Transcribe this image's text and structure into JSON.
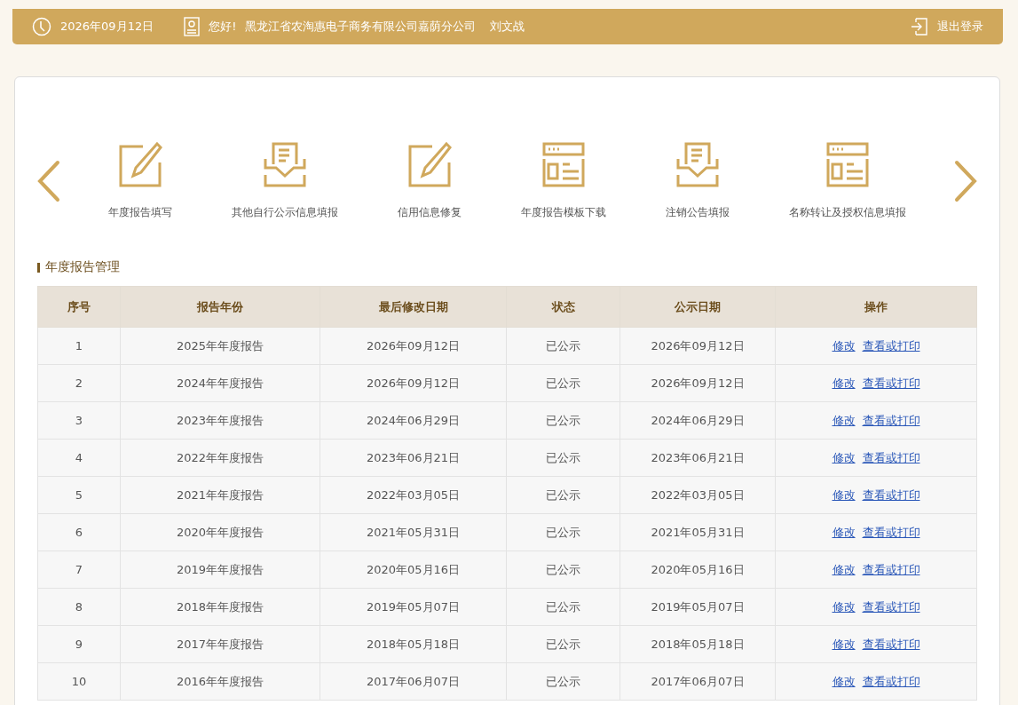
{
  "header": {
    "date": "2026年09月12日",
    "greeting": "您好!",
    "company": "黑龙江省农淘惠电子商务有限公司嘉荫分公司",
    "user": "刘文战",
    "logout": "退出登录"
  },
  "shortcuts": [
    {
      "kind": "edit",
      "label": "年度报告填写"
    },
    {
      "kind": "tray",
      "label": "其他自行公示信息填报"
    },
    {
      "kind": "edit",
      "label": "信用信息修复"
    },
    {
      "kind": "window",
      "label": "年度报告模板下载"
    },
    {
      "kind": "tray",
      "label": "注销公告填报"
    },
    {
      "kind": "window",
      "label": "名称转让及授权信息填报"
    }
  ],
  "section_title": "年度报告管理",
  "table": {
    "columns": [
      "序号",
      "报告年份",
      "最后修改日期",
      "状态",
      "公示日期",
      "操作"
    ],
    "rows": [
      {
        "no": "1",
        "year": "2025年年度报告",
        "modified": "2026年09月12日",
        "status": "已公示",
        "published": "2026年09月12日",
        "actions": [
          "修改",
          "查看或打印"
        ]
      },
      {
        "no": "2",
        "year": "2024年年度报告",
        "modified": "2026年09月12日",
        "status": "已公示",
        "published": "2026年09月12日",
        "actions": [
          "修改",
          "查看或打印"
        ]
      },
      {
        "no": "3",
        "year": "2023年年度报告",
        "modified": "2024年06月29日",
        "status": "已公示",
        "published": "2024年06月29日",
        "actions": [
          "修改",
          "查看或打印"
        ]
      },
      {
        "no": "4",
        "year": "2022年年度报告",
        "modified": "2023年06月21日",
        "status": "已公示",
        "published": "2023年06月21日",
        "actions": [
          "修改",
          "查看或打印"
        ]
      },
      {
        "no": "5",
        "year": "2021年年度报告",
        "modified": "2022年03月05日",
        "status": "已公示",
        "published": "2022年03月05日",
        "actions": [
          "修改",
          "查看或打印"
        ]
      },
      {
        "no": "6",
        "year": "2020年年度报告",
        "modified": "2021年05月31日",
        "status": "已公示",
        "published": "2021年05月31日",
        "actions": [
          "修改",
          "查看或打印"
        ]
      },
      {
        "no": "7",
        "year": "2019年年度报告",
        "modified": "2020年05月16日",
        "status": "已公示",
        "published": "2020年05月16日",
        "actions": [
          "修改",
          "查看或打印"
        ]
      },
      {
        "no": "8",
        "year": "2018年年度报告",
        "modified": "2019年05月07日",
        "status": "已公示",
        "published": "2019年05月07日",
        "actions": [
          "修改",
          "查看或打印"
        ]
      },
      {
        "no": "9",
        "year": "2017年年度报告",
        "modified": "2018年05月18日",
        "status": "已公示",
        "published": "2018年05月18日",
        "actions": [
          "修改",
          "查看或打印"
        ]
      },
      {
        "no": "10",
        "year": "2016年年度报告",
        "modified": "2017年06月07日",
        "status": "已公示",
        "published": "2017年06月07日",
        "actions": [
          "修改",
          "查看或打印"
        ]
      }
    ]
  }
}
